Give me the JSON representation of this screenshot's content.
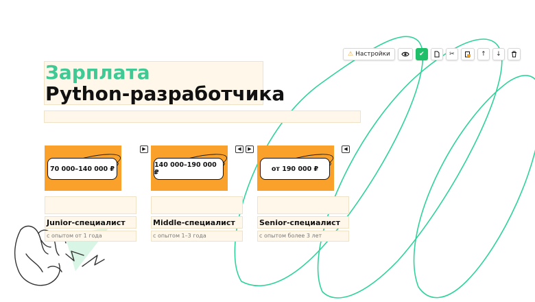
{
  "toolbar": {
    "settings_label": "Настройки",
    "buttons": [
      "settings",
      "visibility",
      "check",
      "copy",
      "cut",
      "paste",
      "move-up",
      "move-down",
      "delete"
    ]
  },
  "title": {
    "line1": "Зарплата",
    "line2": "Python-разработчика"
  },
  "cards": [
    {
      "salary": "70 000–140 000 ₽",
      "level": "Junior-специалист",
      "experience": "с опытом от 1 года"
    },
    {
      "salary": "140 000–190 000 ₽",
      "level": "Middle-специалист",
      "experience": "с опытом 1–3 года"
    },
    {
      "salary": "от 190 000 ₽",
      "level": "Senior-специалист",
      "experience": "с опытом более 3 лет"
    }
  ],
  "arrows": {
    "right": "▶",
    "left": "◀"
  },
  "colors": {
    "accent_green": "#3ec995",
    "card_orange": "#f9a12a",
    "field_bg": "#fff8ea",
    "check_green": "#1fbf6a"
  }
}
